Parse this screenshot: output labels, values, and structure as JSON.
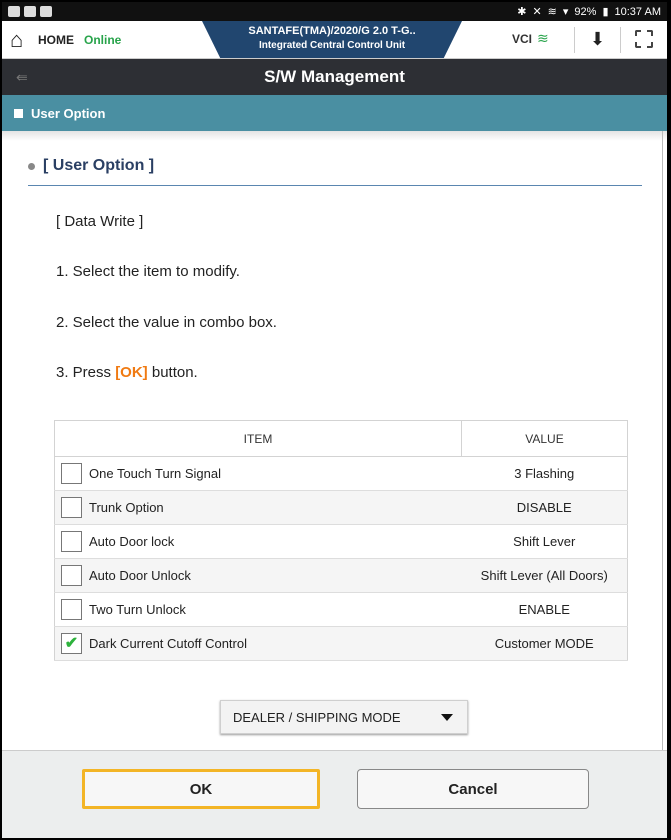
{
  "status_bar": {
    "right_text": "92%",
    "time": "10:37 AM"
  },
  "app_header": {
    "home_label": "HOME",
    "connection_status": "Online",
    "vehicle_line1": "SANTAFE(TMA)/2020/G 2.0 T-G..",
    "vehicle_line2": "Integrated Central Control Unit",
    "vci_label": "VCI"
  },
  "title_bar": {
    "title": "S/W Management"
  },
  "section_bar": {
    "label": "User Option"
  },
  "content": {
    "heading": "[ User Option ]",
    "instructions": {
      "data_write": "[ Data Write ]",
      "step1": "1. Select the item to modify.",
      "step2": "2. Select the value in combo box.",
      "step3_prefix": "3. Press ",
      "step3_ok": "[OK]",
      "step3_suffix": " button."
    },
    "table": {
      "headers": [
        "ITEM",
        "VALUE"
      ],
      "rows": [
        {
          "item": "One Touch Turn Signal",
          "value": "3 Flashing",
          "checked": false
        },
        {
          "item": "Trunk Option",
          "value": "DISABLE",
          "checked": false
        },
        {
          "item": "Auto Door lock",
          "value": "Shift Lever",
          "checked": false
        },
        {
          "item": "Auto Door Unlock",
          "value": "Shift Lever (All Doors)",
          "checked": false
        },
        {
          "item": "Two Turn Unlock",
          "value": "ENABLE",
          "checked": false
        },
        {
          "item": "Dark Current Cutoff Control",
          "value": "Customer MODE",
          "checked": true
        }
      ]
    },
    "combo": {
      "selected": "DEALER / SHIPPING MODE"
    }
  },
  "footer": {
    "ok_label": "OK",
    "cancel_label": "Cancel"
  },
  "colors": {
    "accent_section": "#4a8fa2",
    "title_bar_bg": "#2d2f34",
    "vehicle_banner": "#21466f",
    "ok_highlight": "#f3b526",
    "online_green": "#27a34a",
    "ok_text_orange": "#f07a12"
  }
}
